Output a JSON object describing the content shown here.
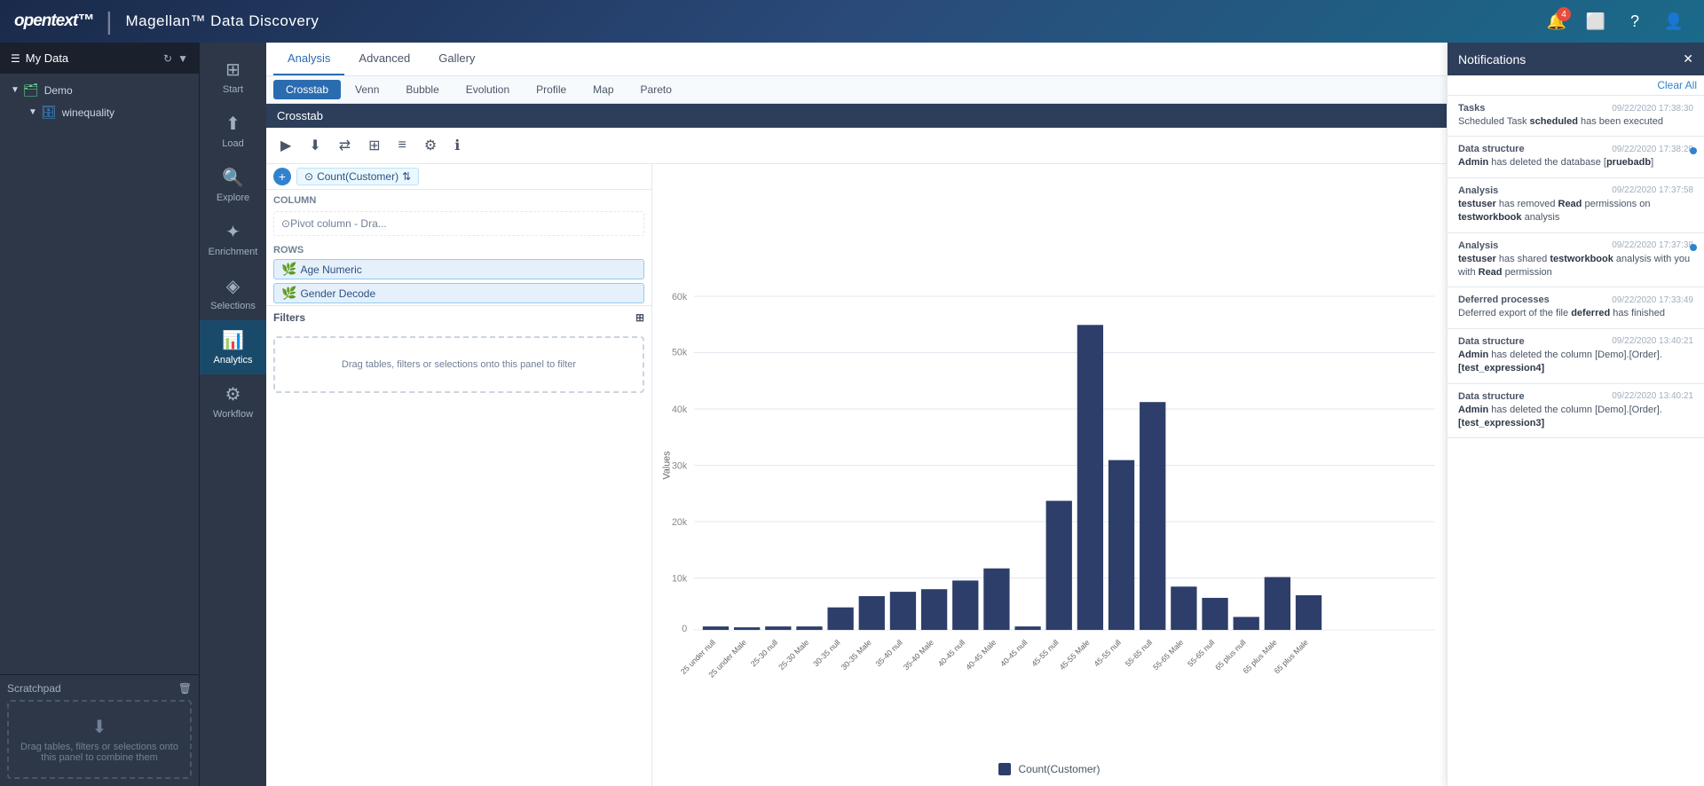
{
  "header": {
    "logo_opentext": "opentext™",
    "separator": "|",
    "logo_magellan": "Magellan™ Data Discovery",
    "icons": {
      "bell_badge": "4",
      "screen_icon": "⬜",
      "question_icon": "?",
      "user_icon": "👤"
    }
  },
  "sidebar": {
    "my_data_label": "My Data",
    "tree_items": [
      {
        "label": "Demo",
        "level": 1,
        "type": "folder"
      },
      {
        "label": "winequality",
        "level": 2,
        "type": "db"
      }
    ],
    "refresh_icon": "↻"
  },
  "nav": {
    "items": [
      {
        "id": "start",
        "label": "Start",
        "icon": "⊞"
      },
      {
        "id": "load",
        "label": "Load",
        "icon": "⬆"
      },
      {
        "id": "explore",
        "label": "Explore",
        "icon": "🔍"
      },
      {
        "id": "enrichment",
        "label": "Enrichment",
        "icon": "✦"
      },
      {
        "id": "selections",
        "label": "Selections",
        "icon": "◈"
      },
      {
        "id": "analytics",
        "label": "Analytics",
        "icon": "📊",
        "active": true
      },
      {
        "id": "workflow",
        "label": "Workflow",
        "icon": "⚙"
      }
    ]
  },
  "scratchpad": {
    "label": "Scratchpad",
    "delete_icon": "🗑",
    "drop_text": "Drag tables, filters or selections onto this panel to combine them",
    "drop_icon": "⬇"
  },
  "top_tabs": [
    {
      "label": "Analysis",
      "active": true
    },
    {
      "label": "Advanced",
      "active": false
    },
    {
      "label": "Gallery",
      "active": false
    }
  ],
  "sub_tabs": [
    {
      "label": "Crosstab",
      "active": true
    },
    {
      "label": "Venn",
      "active": false
    },
    {
      "label": "Bubble",
      "active": false
    },
    {
      "label": "Evolution",
      "active": false
    },
    {
      "label": "Profile",
      "active": false
    },
    {
      "label": "Map",
      "active": false
    },
    {
      "label": "Pareto",
      "active": false
    }
  ],
  "chart_title": "Crosstab",
  "toolbar": {
    "buttons": [
      "▶",
      "⬇",
      "⇄",
      "⊞",
      "≡",
      "⚙",
      "ℹ"
    ]
  },
  "measure_bar": {
    "add_btn": "+",
    "measure_chip": {
      "label": "Count(Customer)",
      "sort_icon": "⇅"
    }
  },
  "column_section": {
    "label": "Column",
    "drop_placeholder": "Pivot column - Dra..."
  },
  "rows_section": {
    "label": "Rows",
    "fields": [
      {
        "label": "Age Numeric",
        "icon": "🌿"
      },
      {
        "label": "Gender Decode",
        "icon": "🌿"
      }
    ]
  },
  "filters_section": {
    "label": "Filters",
    "grid_icon": "⊞",
    "drop_text": "Drag tables, filters or selections onto this panel to filter"
  },
  "bar_chart": {
    "y_axis_label": "Values",
    "legend_label": "Count(Customer)",
    "legend_color": "#2d3e6a",
    "y_max": 60000,
    "bars": [
      {
        "label": "25 under null",
        "value": 600
      },
      {
        "label": "25 under Male",
        "value": 500
      },
      {
        "label": "25-30 null",
        "value": 600
      },
      {
        "label": "25-30 Male",
        "value": 600
      },
      {
        "label": "30-35 null",
        "value": 3800
      },
      {
        "label": "30-35 Male",
        "value": 5800
      },
      {
        "label": "35-40 null",
        "value": 6500
      },
      {
        "label": "35-40 Male",
        "value": 7000
      },
      {
        "label": "40-45 null",
        "value": 8500
      },
      {
        "label": "40-45 Male",
        "value": 10500
      },
      {
        "label": "40-45 null2",
        "value": 600
      },
      {
        "label": "45-55 null",
        "value": 22000
      },
      {
        "label": "45-55 Male",
        "value": 52000
      },
      {
        "label": "45-55 null3",
        "value": 29000
      },
      {
        "label": "55-65 null",
        "value": 39000
      },
      {
        "label": "55-65 Male",
        "value": 7500
      },
      {
        "label": "55-65 null2",
        "value": 5500
      },
      {
        "label": "65 plus null",
        "value": 2200
      },
      {
        "label": "65 plus Male",
        "value": 9000
      },
      {
        "label": "65 plus Male2",
        "value": 6000
      }
    ]
  },
  "notifications": {
    "panel_title": "Notifications",
    "close_icon": "✕",
    "clear_all_label": "Clear All",
    "items": [
      {
        "type": "Tasks",
        "time": "09/22/2020 17:38:30",
        "text": "Scheduled Task **scheduled** has been executed",
        "unread": false,
        "parts": [
          {
            "text": "Scheduled Task ",
            "bold": false
          },
          {
            "text": "scheduled",
            "bold": true
          },
          {
            "text": " has been executed",
            "bold": false
          }
        ]
      },
      {
        "type": "Data structure",
        "time": "09/22/2020 17:38:28",
        "text": "Admin has deleted the database [pruebadb]",
        "unread": true,
        "parts": [
          {
            "text": "Admin",
            "bold": true
          },
          {
            "text": " has deleted the database [",
            "bold": false
          },
          {
            "text": "pruebadb",
            "bold": true
          },
          {
            "text": "]",
            "bold": false
          }
        ]
      },
      {
        "type": "Analysis",
        "time": "09/22/2020 17:37:58",
        "text": "testuser has removed Read permissions on testworkbook analysis",
        "unread": false,
        "parts": [
          {
            "text": "testuser",
            "bold": true
          },
          {
            "text": " has removed ",
            "bold": false
          },
          {
            "text": "Read",
            "bold": true
          },
          {
            "text": " permissions on ",
            "bold": false
          },
          {
            "text": "testworkbook",
            "bold": true
          },
          {
            "text": " analysis",
            "bold": false
          }
        ]
      },
      {
        "type": "Analysis",
        "time": "09/22/2020 17:37:38",
        "text": "testuser has shared testworkbook analysis with you with Read permission",
        "unread": true,
        "parts": [
          {
            "text": "testuser",
            "bold": true
          },
          {
            "text": " has shared ",
            "bold": false
          },
          {
            "text": "testworkbook",
            "bold": true
          },
          {
            "text": " analysis with you with ",
            "bold": false
          },
          {
            "text": "Read",
            "bold": true
          },
          {
            "text": " permission",
            "bold": false
          }
        ]
      },
      {
        "type": "Deferred processes",
        "time": "09/22/2020 17:33:49",
        "text": "Deferred export of the file deferred has finished",
        "unread": false,
        "parts": [
          {
            "text": "Deferred export of the file ",
            "bold": false
          },
          {
            "text": "deferred",
            "bold": true
          },
          {
            "text": " has finished",
            "bold": false
          }
        ]
      },
      {
        "type": "Data structure",
        "time": "09/22/2020 13:40:21",
        "text": "Admin has deleted the column [Demo].[Order].[test_expression4]",
        "unread": false,
        "parts": [
          {
            "text": "Admin",
            "bold": true
          },
          {
            "text": " has deleted the column [",
            "bold": false
          },
          {
            "text": "Demo].[Order].",
            "bold": false
          },
          {
            "text": "[test_expression4]",
            "bold": true
          }
        ]
      },
      {
        "type": "Data structure",
        "time": "09/22/2020 13:40:21",
        "text": "Admin has deleted the column [Demo].[Order].[test_expression3]",
        "unread": false,
        "parts": [
          {
            "text": "Admin",
            "bold": true
          },
          {
            "text": " has deleted the column [",
            "bold": false
          },
          {
            "text": "Demo].[Order].",
            "bold": false
          },
          {
            "text": "[test_expression3]",
            "bold": true
          }
        ]
      }
    ]
  }
}
